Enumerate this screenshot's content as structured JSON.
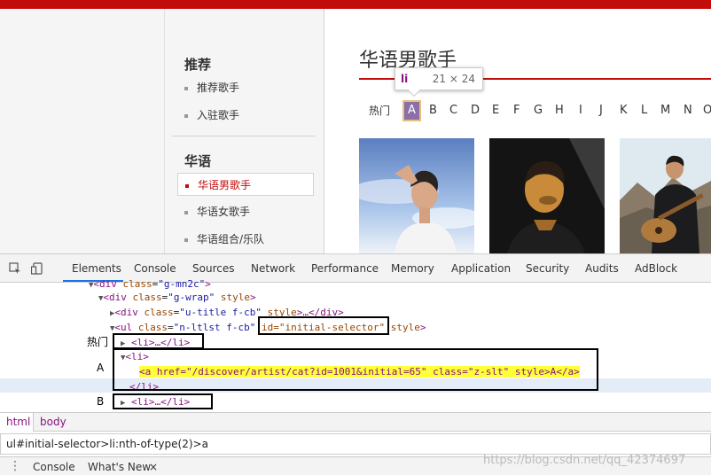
{
  "site": {
    "sidebar": {
      "group1_title": "推荐",
      "group1_items": [
        "推荐歌手",
        "入驻歌手"
      ],
      "group2_title": "华语",
      "group2_items": [
        "华语男歌手",
        "华语女歌手",
        "华语组合/乐队"
      ]
    },
    "page_title": "华语男歌手",
    "tooltip": {
      "tag": "li",
      "size": "21 × 24"
    },
    "letters": {
      "hot": "热门",
      "list": [
        "A",
        "B",
        "C",
        "D",
        "E",
        "F",
        "G",
        "H",
        "I",
        "J",
        "K",
        "L",
        "M",
        "N",
        "O"
      ],
      "selected": "A"
    }
  },
  "devtools": {
    "tabs": [
      "Elements",
      "Console",
      "Sources",
      "Network",
      "Performance",
      "Memory",
      "Application",
      "Security",
      "Audits",
      "AdBlock"
    ],
    "active_tab": "Elements",
    "tree": {
      "l0": {
        "tag": "div",
        "attr": "class",
        "val": "\"g-mn2c\""
      },
      "l1": {
        "tag": "div",
        "attr": "class",
        "val": "\"g-wrap\"",
        "attr2": "style"
      },
      "l2": {
        "tag": "div",
        "attr": "class",
        "val": "\"u-title f-cb\"",
        "attr2": "style",
        "close": "…</div>"
      },
      "l3": {
        "tag": "ul",
        "attr": "class",
        "val": "\"n-ltlst f-cb\"",
        "id_attr": "id=\"initial-selector\"",
        "attr2": "style"
      },
      "l4": "<li>…</li>",
      "l5": "<li>",
      "l6": "<a href=\"/discover/artist/cat?id=1001&initial=65\" class=\"z-slt\" style>A</a>",
      "l7": "</li>",
      "l8": "<li>…</li>"
    },
    "annotations": {
      "hot": "热门",
      "a": "A",
      "b": "B"
    },
    "breadcrumbs": [
      "html",
      "body"
    ],
    "search_value": "ul#initial-selector>li:nth-of-type(2)>a",
    "drawer": {
      "console": "Console",
      "whatsnew": "What's New",
      "close": "×"
    }
  },
  "watermark": "https://blog.csdn.net/qq_42374697"
}
